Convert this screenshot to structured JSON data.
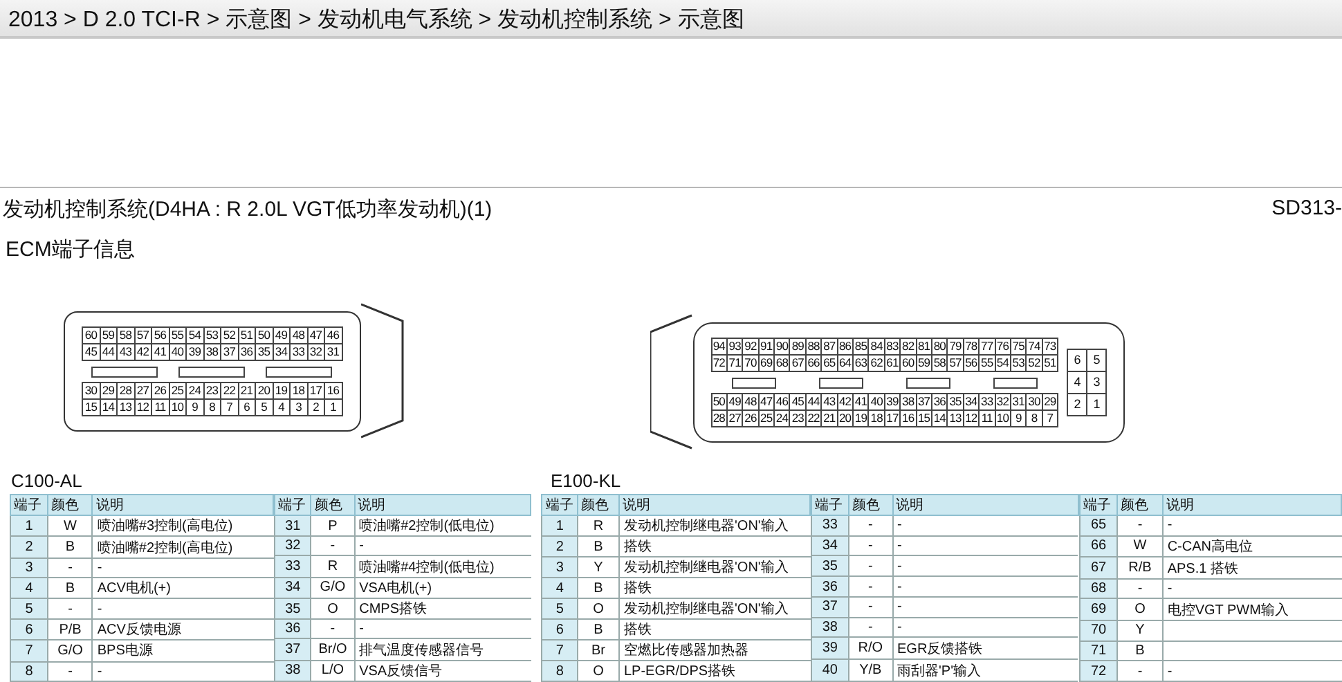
{
  "breadcrumb": "2013 > D 2.0 TCI-R > 示意图 > 发动机电气系统 > 发动机控制系统 > 示意图",
  "document": {
    "title": "发动机控制系统(D4HA : R 2.0L VGT低功率发动机)(1)",
    "code": "SD313-",
    "section": "ECM端子信息"
  },
  "connectors": [
    {
      "name": "C100-AL",
      "top_rows": [
        [
          "60",
          "59",
          "58",
          "57",
          "56",
          "55",
          "54",
          "53",
          "52",
          "51",
          "50",
          "49",
          "48",
          "47",
          "46"
        ],
        [
          "45",
          "44",
          "43",
          "42",
          "41",
          "40",
          "39",
          "38",
          "37",
          "36",
          "35",
          "34",
          "33",
          "32",
          "31"
        ]
      ],
      "bottom_rows": [
        [
          "30",
          "29",
          "28",
          "27",
          "26",
          "25",
          "24",
          "23",
          "22",
          "21",
          "20",
          "19",
          "18",
          "17",
          "16"
        ],
        [
          "15",
          "14",
          "13",
          "12",
          "11",
          "10",
          "9",
          "8",
          "7",
          "6",
          "5",
          "4",
          "3",
          "2",
          "1"
        ]
      ],
      "column_groups": [
        {
          "header": [
            "端子",
            "颜色",
            "说明"
          ],
          "rows": [
            {
              "pin": "1",
              "wire": "W",
              "desc": "喷油嘴#3控制(高电位)"
            },
            {
              "pin": "2",
              "wire": "B",
              "desc": "喷油嘴#2控制(高电位)"
            },
            {
              "pin": "3",
              "wire": "-",
              "desc": "-"
            },
            {
              "pin": "4",
              "wire": "B",
              "desc": "ACV电机(+)"
            },
            {
              "pin": "5",
              "wire": "-",
              "desc": "-"
            },
            {
              "pin": "6",
              "wire": "P/B",
              "desc": "ACV反馈电源"
            },
            {
              "pin": "7",
              "wire": "G/O",
              "desc": "BPS电源"
            },
            {
              "pin": "8",
              "wire": "-",
              "desc": "-"
            }
          ]
        },
        {
          "header": [
            "端子",
            "颜色",
            "说明"
          ],
          "rows": [
            {
              "pin": "31",
              "wire": "P",
              "desc": "喷油嘴#2控制(低电位)"
            },
            {
              "pin": "32",
              "wire": "-",
              "desc": "-"
            },
            {
              "pin": "33",
              "wire": "R",
              "desc": "喷油嘴#4控制(低电位)"
            },
            {
              "pin": "34",
              "wire": "G/O",
              "desc": "VSA电机(+)"
            },
            {
              "pin": "35",
              "wire": "O",
              "desc": "CMPS搭铁"
            },
            {
              "pin": "36",
              "wire": "-",
              "desc": "-"
            },
            {
              "pin": "37",
              "wire": "Br/O",
              "desc": "排气温度传感器信号"
            },
            {
              "pin": "38",
              "wire": "L/O",
              "desc": "VSA反馈信号"
            }
          ]
        }
      ]
    },
    {
      "name": "E100-KL",
      "top_rows": [
        [
          "94",
          "93",
          "92",
          "91",
          "90",
          "89",
          "88",
          "87",
          "86",
          "85",
          "84",
          "83",
          "82",
          "81",
          "80",
          "79",
          "78",
          "77",
          "76",
          "75",
          "74",
          "73"
        ],
        [
          "72",
          "71",
          "70",
          "69",
          "68",
          "67",
          "66",
          "65",
          "64",
          "63",
          "62",
          "61",
          "60",
          "59",
          "58",
          "57",
          "56",
          "55",
          "54",
          "53",
          "52",
          "51"
        ]
      ],
      "bottom_rows": [
        [
          "50",
          "49",
          "48",
          "47",
          "46",
          "45",
          "44",
          "43",
          "42",
          "41",
          "40",
          "39",
          "38",
          "37",
          "36",
          "35",
          "34",
          "33",
          "32",
          "31",
          "30",
          "29"
        ],
        [
          "28",
          "27",
          "26",
          "25",
          "24",
          "23",
          "22",
          "21",
          "20",
          "19",
          "18",
          "17",
          "16",
          "15",
          "14",
          "13",
          "12",
          "11",
          "10",
          "9",
          "8",
          "7"
        ]
      ],
      "side_rows": [
        [
          "6",
          "5"
        ],
        [
          "4",
          "3"
        ],
        [
          "2",
          "1"
        ]
      ],
      "column_groups": [
        {
          "header": [
            "端子",
            "颜色",
            "说明"
          ],
          "rows": [
            {
              "pin": "1",
              "wire": "R",
              "desc": "发动机控制继电器'ON'输入"
            },
            {
              "pin": "2",
              "wire": "B",
              "desc": "搭铁"
            },
            {
              "pin": "3",
              "wire": "Y",
              "desc": "发动机控制继电器'ON'输入"
            },
            {
              "pin": "4",
              "wire": "B",
              "desc": "搭铁"
            },
            {
              "pin": "5",
              "wire": "O",
              "desc": "发动机控制继电器'ON'输入"
            },
            {
              "pin": "6",
              "wire": "B",
              "desc": "搭铁"
            },
            {
              "pin": "7",
              "wire": "Br",
              "desc": "空燃比传感器加热器"
            },
            {
              "pin": "8",
              "wire": "O",
              "desc": "LP-EGR/DPS搭铁"
            }
          ]
        },
        {
          "header": [
            "端子",
            "颜色",
            "说明"
          ],
          "rows": [
            {
              "pin": "33",
              "wire": "-",
              "desc": "-"
            },
            {
              "pin": "34",
              "wire": "-",
              "desc": "-"
            },
            {
              "pin": "35",
              "wire": "-",
              "desc": "-"
            },
            {
              "pin": "36",
              "wire": "-",
              "desc": "-"
            },
            {
              "pin": "37",
              "wire": "-",
              "desc": "-"
            },
            {
              "pin": "38",
              "wire": "-",
              "desc": "-"
            },
            {
              "pin": "39",
              "wire": "R/O",
              "desc": "EGR反馈搭铁"
            },
            {
              "pin": "40",
              "wire": "Y/B",
              "desc": "雨刮器'P'输入"
            }
          ]
        },
        {
          "header": [
            "端子",
            "颜色",
            "说明"
          ],
          "rows": [
            {
              "pin": "65",
              "wire": "-",
              "desc": "-"
            },
            {
              "pin": "66",
              "wire": "W",
              "desc": "C-CAN高电位"
            },
            {
              "pin": "67",
              "wire": "R/B",
              "desc": "APS.1 搭铁"
            },
            {
              "pin": "68",
              "wire": "-",
              "desc": "-"
            },
            {
              "pin": "69",
              "wire": "O",
              "desc": "电控VGT PWM输入"
            },
            {
              "pin": "70",
              "wire": "Y"
            },
            {
              "pin": "71",
              "wire": "B"
            },
            {
              "pin": "72",
              "wire": "-",
              "desc": "-"
            }
          ]
        }
      ]
    }
  ]
}
